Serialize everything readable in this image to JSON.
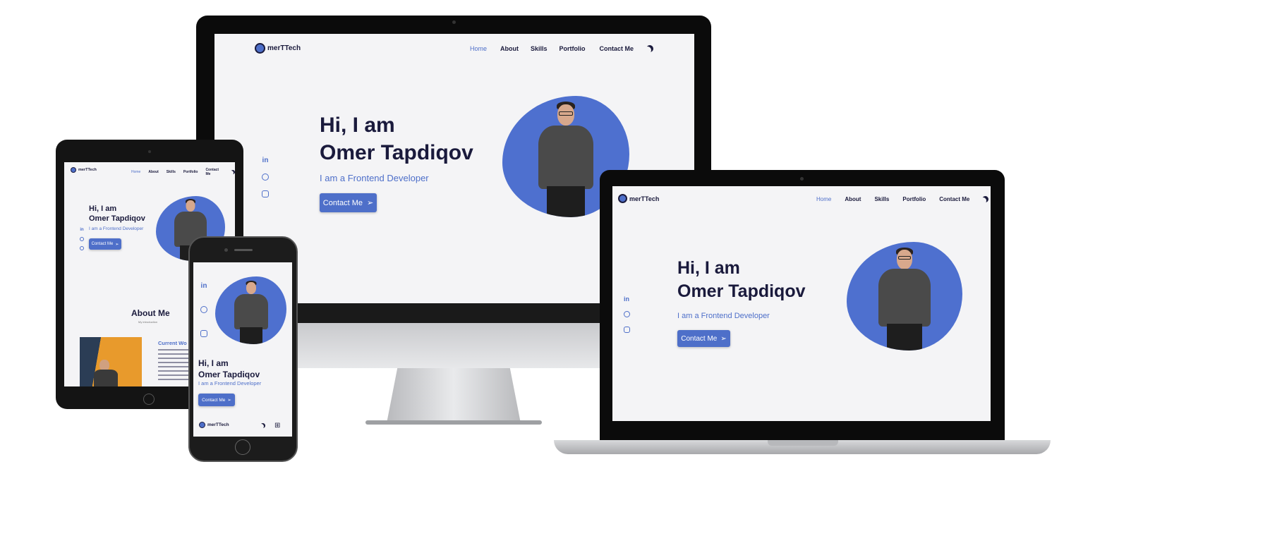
{
  "site": {
    "brand": "merTTech",
    "nav": [
      "Home",
      "About",
      "Skills",
      "Portfolio",
      "Contact Me"
    ],
    "greeting": "Hi, I am",
    "name": "Omer Tapdiqov",
    "role": "I am a Frontend Developer",
    "cta": "Contact Me",
    "about_title": "About Me",
    "about_sub": "My introduction",
    "current_work": "Current Wo",
    "social_linkedin": "in",
    "icons": [
      "linkedin-icon",
      "github-icon",
      "instagram-icon",
      "moon-icon",
      "send-icon",
      "apps-icon"
    ]
  },
  "colors": {
    "accent": "#4e6fc9",
    "text_dark": "#1a1a3c",
    "background": "#f4f4f6"
  }
}
